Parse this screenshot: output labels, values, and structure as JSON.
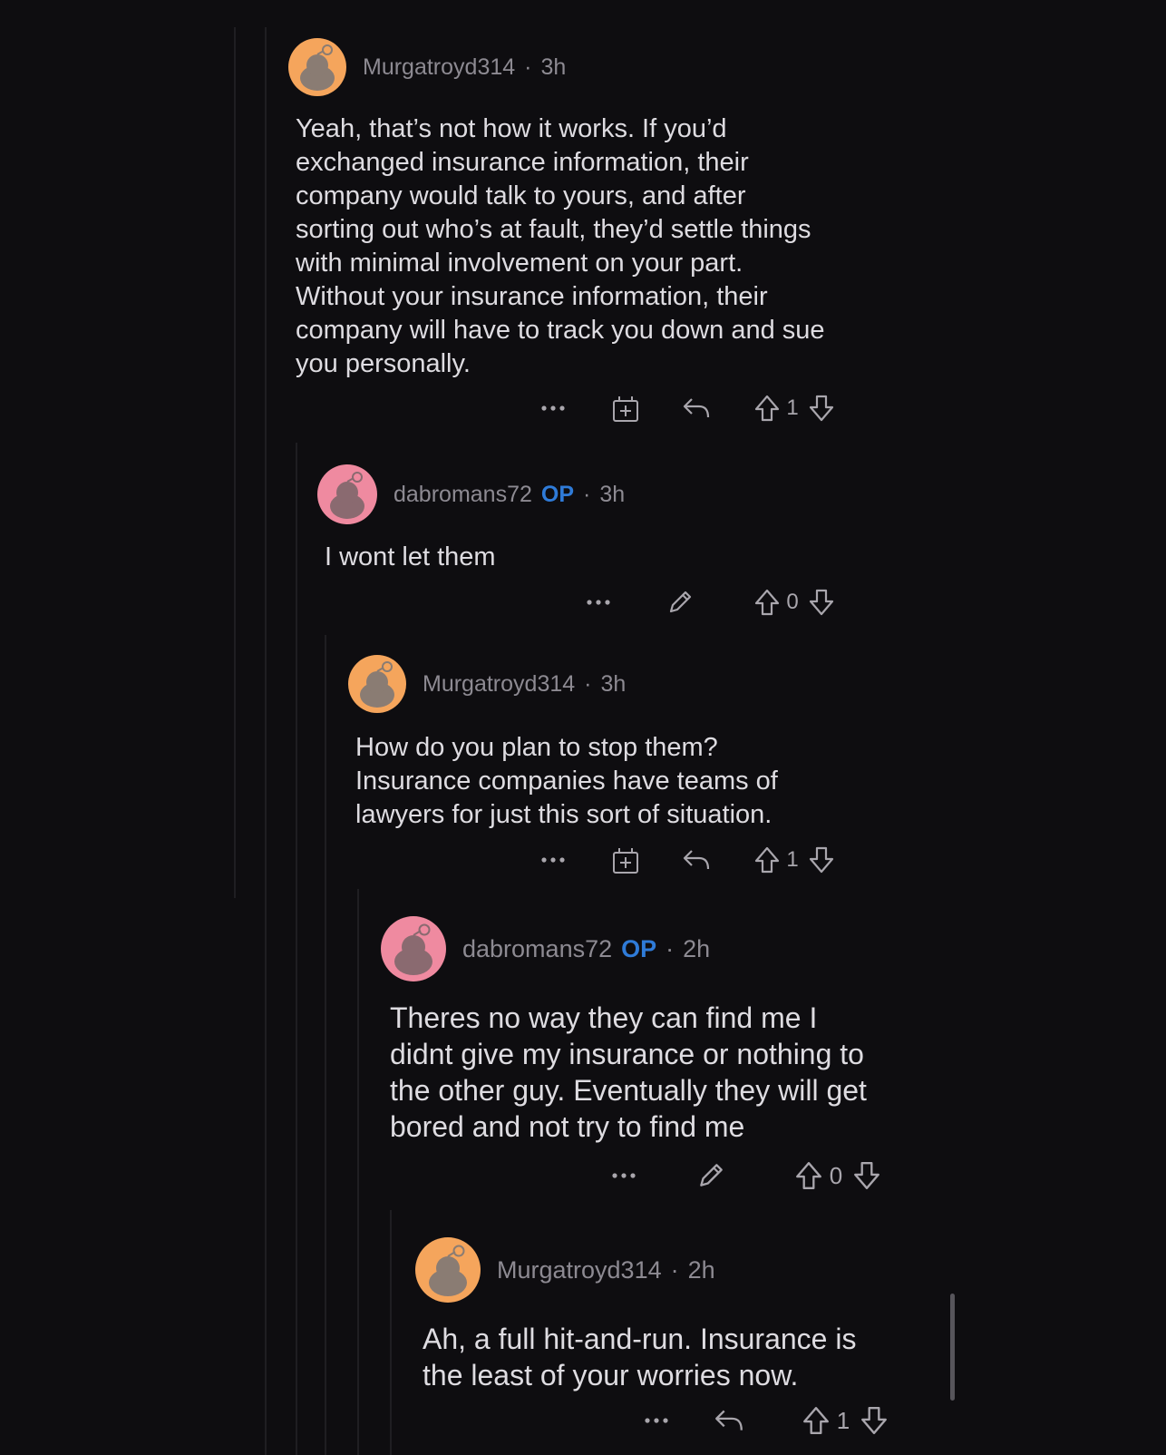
{
  "comments": [
    {
      "author": "Murgatroyd314",
      "is_op": false,
      "op_label": "",
      "separator": "·",
      "age": "3h",
      "avatar": "orange-snoo-avatar",
      "body": "Yeah, that’s not how it works. If you’d\nexchanged insurance information, their\ncompany would talk to yours, and after\nsorting out who’s at fault, they’d settle things\nwith minimal involvement on your part.\nWithout your insurance information, their\ncompany will have to track you down and sue\nyou personally.",
      "score": "1",
      "actions": [
        "more-icon",
        "award-icon",
        "reply-icon",
        "upvote-icon",
        "downvote-icon"
      ]
    },
    {
      "author": "dabromans72",
      "is_op": true,
      "op_label": "OP",
      "separator": "·",
      "age": "3h",
      "avatar": "pink-snoo-avatar",
      "body": "I wont let them",
      "score": "0",
      "actions": [
        "more-icon",
        "edit-icon",
        "upvote-icon",
        "downvote-icon"
      ]
    },
    {
      "author": "Murgatroyd314",
      "is_op": false,
      "op_label": "",
      "separator": "·",
      "age": "3h",
      "avatar": "orange-snoo-avatar",
      "body": "How do you plan to stop them?\nInsurance companies have teams of\nlawyers for just this sort of situation.",
      "score": "1",
      "actions": [
        "more-icon",
        "award-icon",
        "reply-icon",
        "upvote-icon",
        "downvote-icon"
      ]
    },
    {
      "author": "dabromans72",
      "is_op": true,
      "op_label": "OP",
      "separator": "·",
      "age": "2h",
      "avatar": "pink-snoo-avatar",
      "body": "Theres no way they can find me I\ndidnt give my insurance or nothing to\nthe other guy. Eventually they will get\nbored and not try to find me",
      "score": "0",
      "actions": [
        "more-icon",
        "edit-icon",
        "upvote-icon",
        "downvote-icon"
      ]
    },
    {
      "author": "Murgatroyd314",
      "is_op": false,
      "op_label": "",
      "separator": "·",
      "age": "2h",
      "avatar": "orange-snoo-avatar",
      "body": "Ah, a full hit-and-run. Insurance is\nthe least of your worries now.",
      "score": "1",
      "actions": [
        "more-icon",
        "reply-icon",
        "upvote-icon",
        "downvote-icon"
      ]
    }
  ],
  "colors": {
    "background": "#0e0d10",
    "text": "#dedce1",
    "meta": "#8d8a92",
    "op": "#2f7bd8",
    "avatar_orange": "#f5a55c",
    "avatar_pink": "#ef8aa0",
    "icon": "#a9a6ad"
  }
}
